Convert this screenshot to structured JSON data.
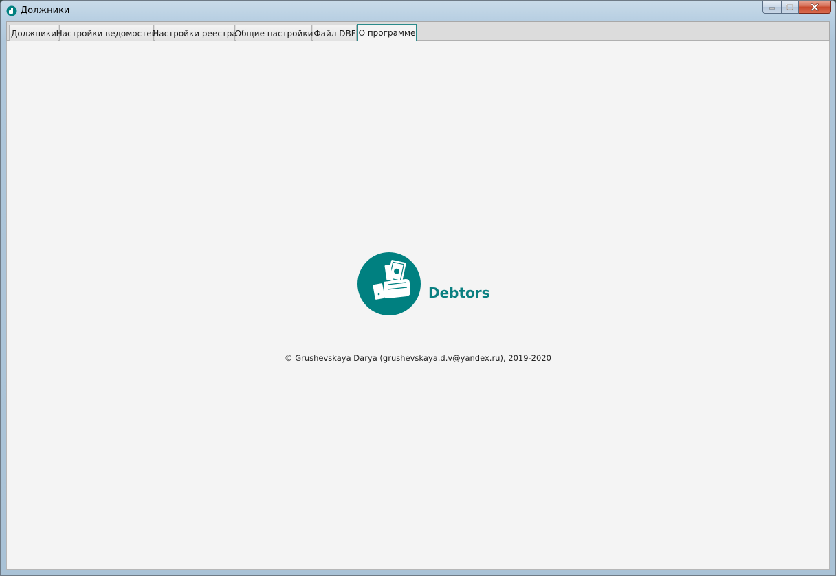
{
  "window": {
    "title": "Должники",
    "icon": "app-icon",
    "caption_buttons": [
      "minimize-icon",
      "maximize-icon",
      "close-icon"
    ]
  },
  "tabs": [
    {
      "label": "Должники"
    },
    {
      "label": "Настройки ведомостей"
    },
    {
      "label": "Настройки реестра"
    },
    {
      "label": "Общие настройки"
    },
    {
      "label": "Файл DBF"
    },
    {
      "label": "О программе"
    }
  ],
  "active_tab": "О программе",
  "about": {
    "logo_icon": "hand-holding-money-icon",
    "app_name": "Debtors",
    "copyright": "© Grushevskaya Darya (grushevskaya.d.v@yandex.ru), 2019-2020"
  },
  "colors": {
    "accent": "#008080",
    "content_bg": "#f4f4f4"
  }
}
